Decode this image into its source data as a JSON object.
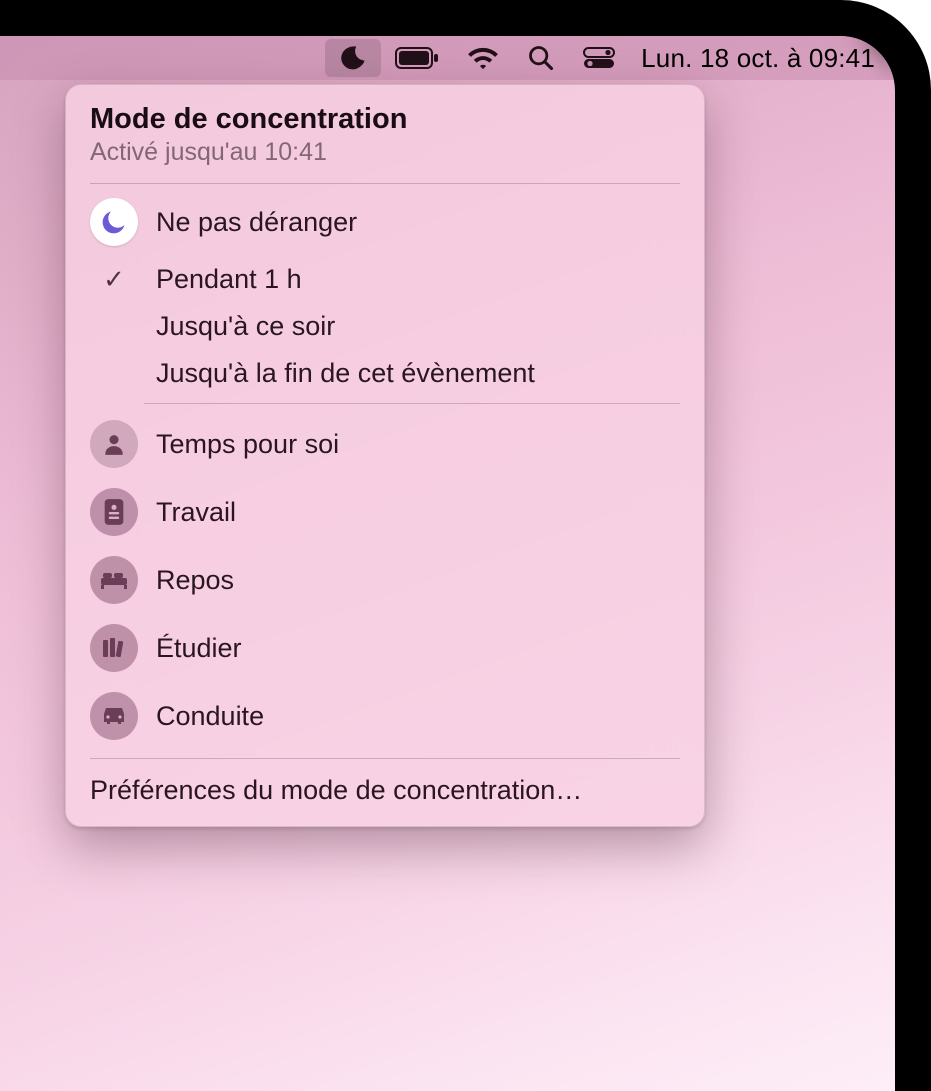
{
  "menubar": {
    "datetime": "Lun. 18 oct. à  09:41"
  },
  "panel": {
    "title": "Mode de concentration",
    "subtitle": "Activé jusqu'au 10:41",
    "dnd_label": "Ne pas déranger",
    "durations": {
      "one_hour": "Pendant 1 h",
      "until_evening": "Jusqu'à ce soir",
      "until_event_end": "Jusqu'à la fin de cet évènement"
    },
    "modes": {
      "personal": "Temps pour soi",
      "work": "Travail",
      "sleep": "Repos",
      "study": "Étudier",
      "driving": "Conduite"
    },
    "prefs_link": "Préférences du mode de concentration…"
  }
}
